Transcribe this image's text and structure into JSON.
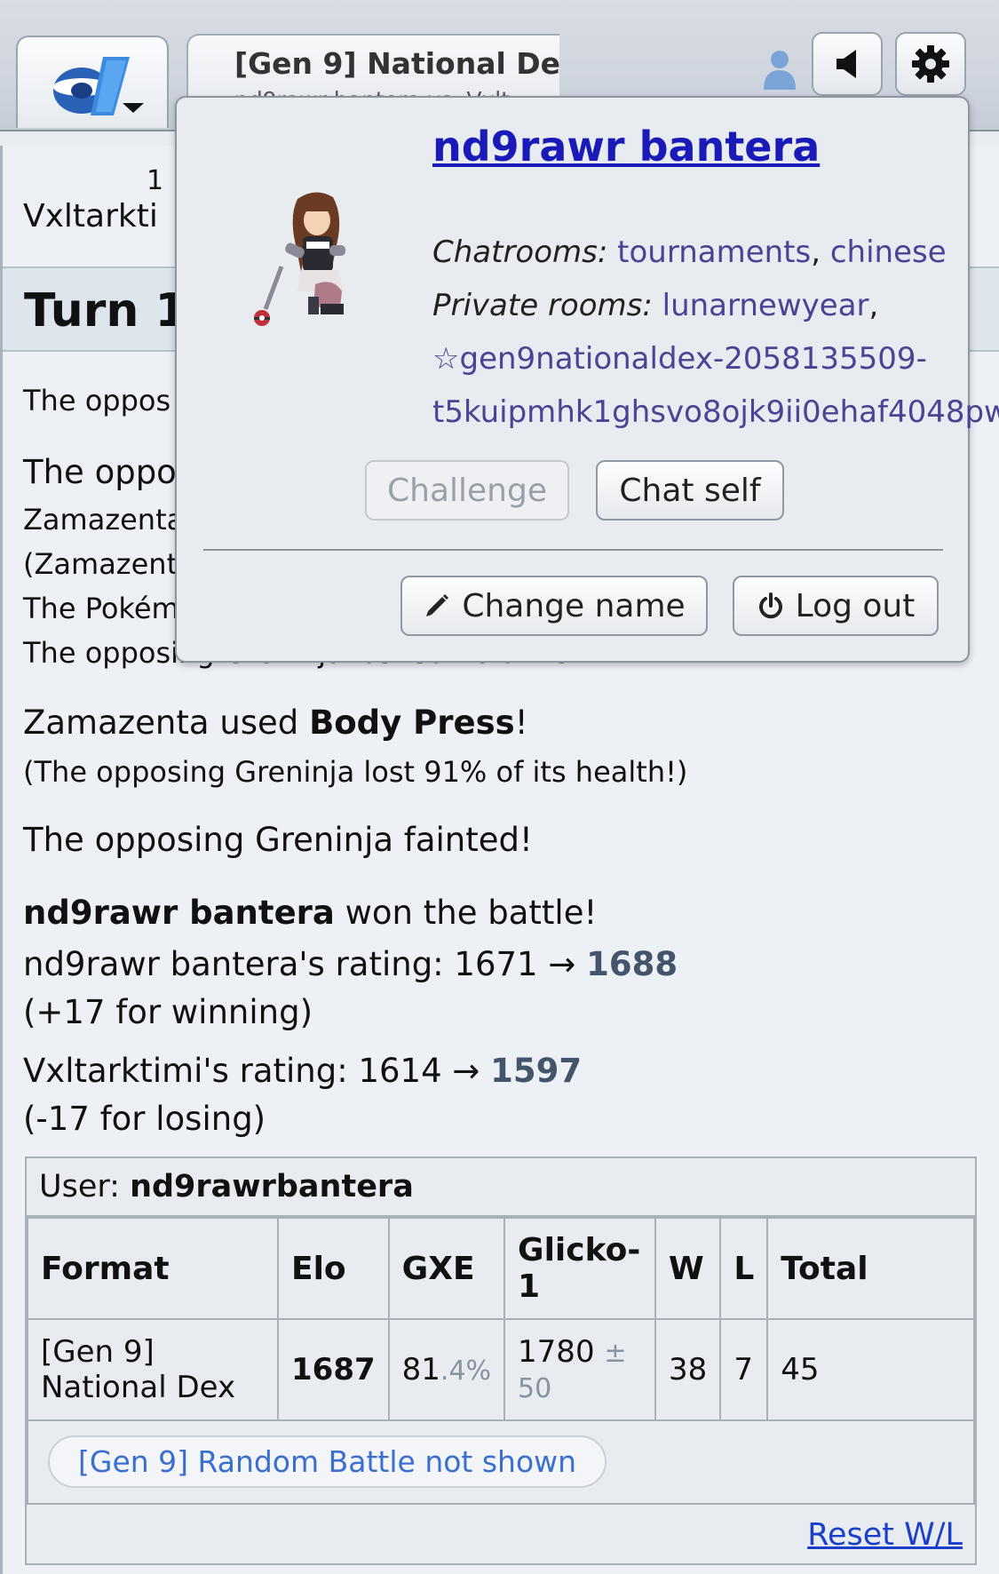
{
  "header": {
    "room_title": "[Gen 9] National De",
    "room_subtitle": "nd9rawr bantera vs. Vxlt",
    "icons": [
      "pokemon-showdown-logo-icon",
      "user-icon",
      "sound-icon",
      "gear-icon"
    ]
  },
  "log": {
    "mini_number": "1",
    "mini_name": "Vxltarkti",
    "turn_label": "Turn 1",
    "line1": "The oppos",
    "line2": "The oppo",
    "line3": "Zamazenta",
    "line4": "(Zamazent",
    "line5": "The Pokém",
    "line6": "The opposing Greninja lost some of its HP!",
    "move_prefix": "Zamazenta used ",
    "move_name": "Body Press",
    "move_suffix": "!",
    "damage": "(The opposing Greninja lost 91% of its health!)",
    "faint": "The opposing Greninja fainted!",
    "winner": "nd9rawr bantera",
    "won_text": " won the battle!",
    "rating1_prefix": "nd9rawr bantera's rating: 1671 → ",
    "rating1_new": "1688",
    "rating1_change": "(+17 for winning)",
    "rating2_prefix": "Vxltarktimi's rating: 1614 → ",
    "rating2_new": "1597",
    "rating2_change": "(-17 for losing)"
  },
  "ratings": {
    "user_label": "User: ",
    "user_name": "nd9rawrbantera",
    "headers": [
      "Format",
      "Elo",
      "GXE",
      "Glicko-1",
      "W",
      "L",
      "Total"
    ],
    "row": {
      "format": "[Gen 9] National Dex",
      "elo": "1687",
      "gxe_main": "81",
      "gxe_decimal": ".4%",
      "glicko": "1780",
      "glicko_dev": "± 50",
      "w": "38",
      "l": "7",
      "total": "45"
    },
    "hidden_format": "[Gen 9] Random Battle not shown",
    "reset_label": "Reset W/L"
  },
  "popup": {
    "name": "nd9rawr bantera",
    "chatrooms_label": "Chatrooms:",
    "chatrooms": [
      "tournaments",
      "chinese"
    ],
    "private_label": "Private rooms:",
    "private_rooms": [
      "lunarnewyear",
      "☆gen9nationaldex-2058135509-",
      "t5kuipmhk1ghsvo8ojk9ii0ehaf4048pw"
    ],
    "challenge_label": "Challenge",
    "chat_self_label": "Chat self",
    "change_name_label": "Change name",
    "logout_label": "Log out"
  }
}
